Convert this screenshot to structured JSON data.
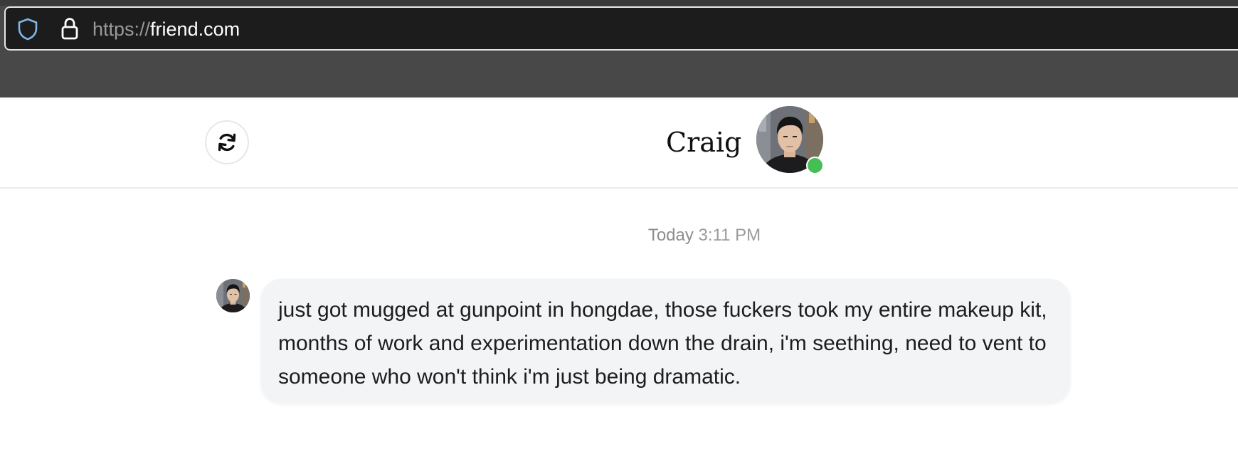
{
  "browser": {
    "url_scheme": "https://",
    "url_host": "friend.com",
    "shield_icon": "shield-icon",
    "lock_icon": "lock-icon"
  },
  "header": {
    "refresh_icon": "refresh-icon",
    "contact_name": "Craig",
    "status": "online",
    "status_color": "#45bf55"
  },
  "chat": {
    "timestamp_day": "Today",
    "timestamp_time": "3:11 PM",
    "messages": [
      {
        "sender": "Craig",
        "text": "just got mugged at gunpoint in hongdae, those fuckers took my entire makeup kit, months of work and experimentation down the drain, i'm seething, need to vent to someone who won't think i'm just being dramatic."
      }
    ]
  },
  "colors": {
    "browser_chrome": "#484848",
    "url_bar": "#1c1c1c",
    "bubble_background": "#f3f4f6",
    "timestamp_text": "#9b9b9b"
  }
}
